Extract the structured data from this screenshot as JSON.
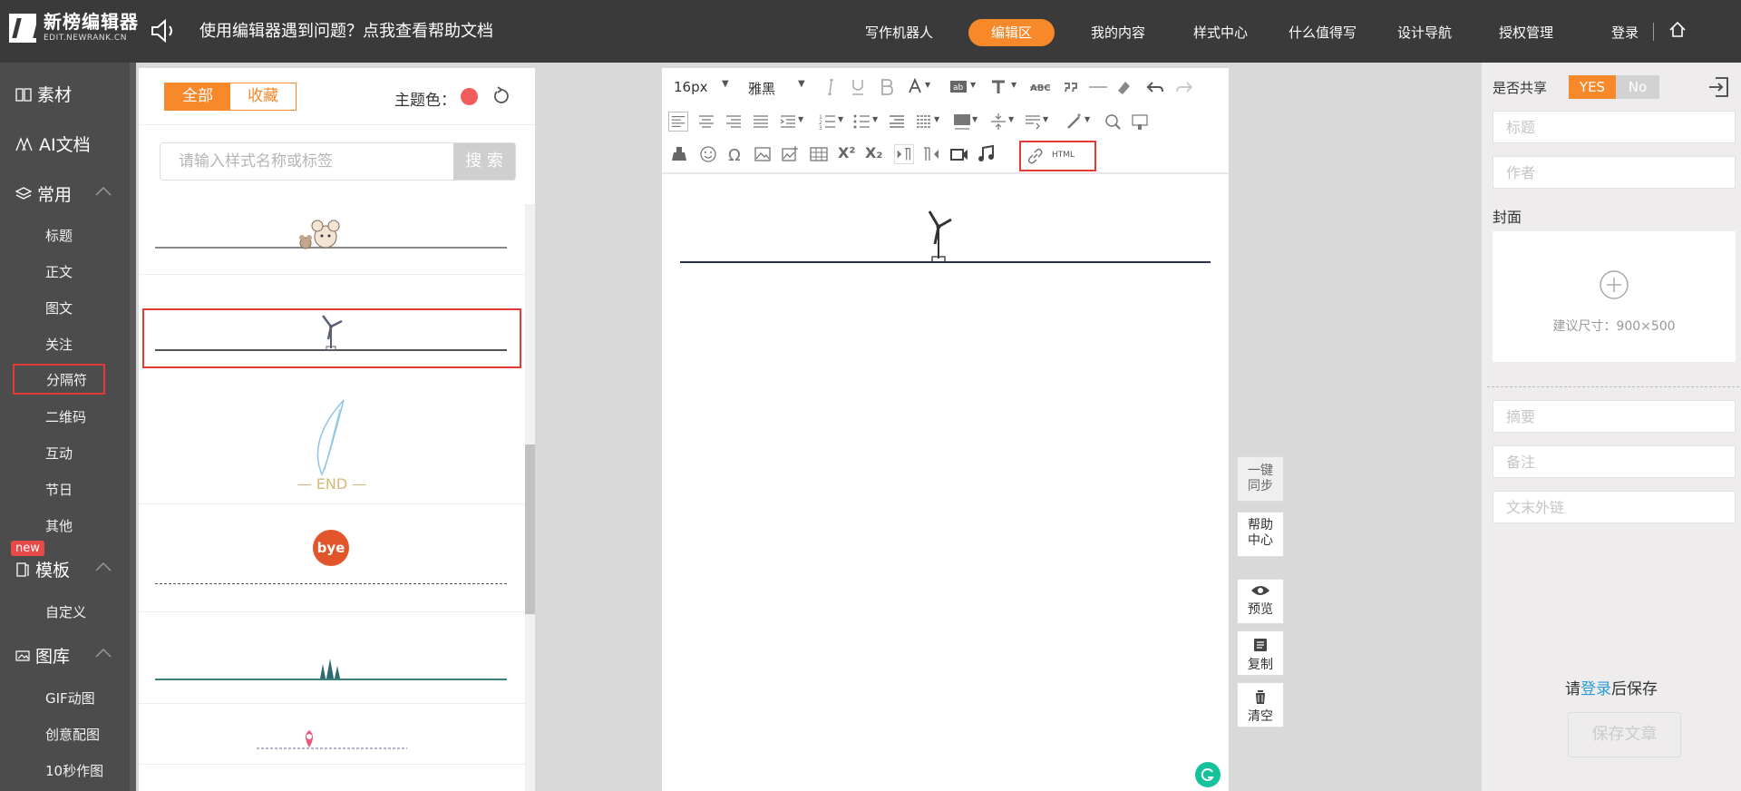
{
  "brand": {
    "name": "新榜编辑器",
    "domain": "EDIT.NEWRANK.CN"
  },
  "header": {
    "help_text": "使用编辑器遇到问题？点我查看帮助文档",
    "nav": [
      "写作机器人",
      "编辑区",
      "我的内容",
      "样式中心",
      "什么值得写",
      "设计导航",
      "授权管理"
    ],
    "active_nav": "编辑区",
    "login": "登录"
  },
  "leftnav": {
    "sucai": "素材",
    "ai": "AI文档",
    "common": "常用",
    "common_items": [
      "标题",
      "正文",
      "图文",
      "关注",
      "分隔符",
      "二维码",
      "互动",
      "节日",
      "其他"
    ],
    "selected_item": "分隔符",
    "new_badge": "new",
    "template": "模板",
    "template_items": [
      "自定义"
    ],
    "gallery": "图库",
    "gallery_items": [
      "GIF动图",
      "创意配图",
      "10秒作图"
    ]
  },
  "stylepanel": {
    "tab_all": "全部",
    "tab_fav": "收藏",
    "theme_label": "主题色：",
    "search_placeholder": "请输入样式名称或标签",
    "search_btn": "搜 索",
    "end_text": "— END —",
    "bye_text": "bye"
  },
  "editor": {
    "font_size": "16px",
    "font_family": "雅黑",
    "html_label": "HTML"
  },
  "side_actions": {
    "sync": "一键同步",
    "help": "帮助中心",
    "preview": "预览",
    "copy": "复制",
    "clear": "清空"
  },
  "rightpanel": {
    "share_label": "是否共享",
    "yes": "YES",
    "no": "No",
    "title_ph": "标题",
    "author_ph": "作者",
    "cover_label": "封面",
    "cover_hint": "建议尺寸：900×500",
    "summary_ph": "摘要",
    "note_ph": "备注",
    "link_ph": "文末外链",
    "save_hint_pre": "请",
    "save_hint_link": "登录",
    "save_hint_post": "后保存",
    "save_btn": "保存文章"
  },
  "colors": {
    "accent": "#f7892b",
    "topbar": "#3a3a3a",
    "leftnav": "#4c4c4c",
    "highlight": "#e53935"
  }
}
